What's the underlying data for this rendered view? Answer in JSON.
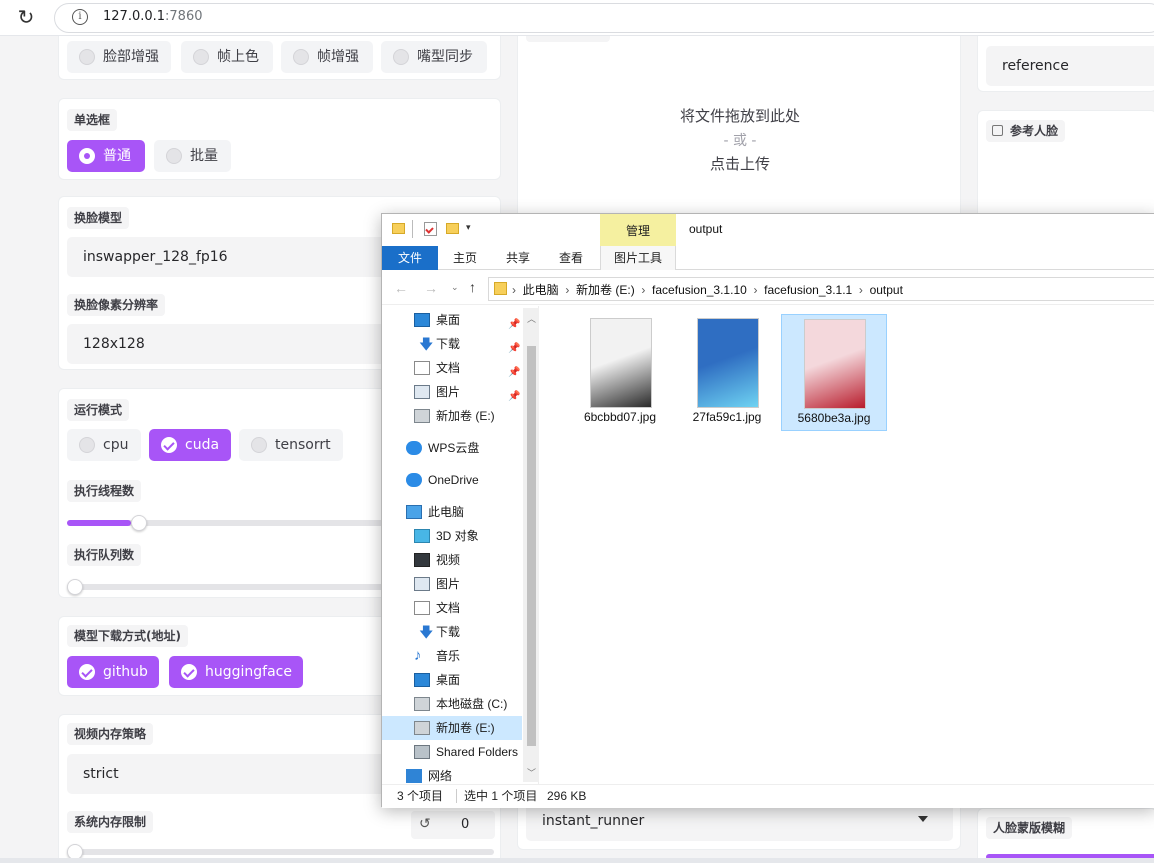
{
  "browser": {
    "reload_icon": "reload-icon",
    "info_icon": "i",
    "url_host": "127.0.0.1",
    "url_port": ":7860"
  },
  "left": {
    "processor_options": [
      "脸部增强",
      "帧上色",
      "帧增强",
      "嘴型同步"
    ],
    "radio_group": {
      "label": "单选框",
      "options": [
        "普通",
        "批量"
      ],
      "selected": "普通"
    },
    "swap_model": {
      "label": "换脸模型",
      "value": "inswapper_128_fp16"
    },
    "swap_resolution": {
      "label": "换脸像素分辨率",
      "value": "128x128"
    },
    "run_mode": {
      "label": "运行模式",
      "options": [
        "cpu",
        "cuda",
        "tensorrt"
      ],
      "checked": [
        "cuda"
      ]
    },
    "thread_count": {
      "label": "执行线程数",
      "value_fraction": 0.15
    },
    "queue_count": {
      "label": "执行队列数",
      "value_fraction": 0.0
    },
    "download": {
      "label": "模型下载方式(地址)",
      "options": [
        "github",
        "huggingface"
      ],
      "checked": [
        "github",
        "huggingface"
      ]
    },
    "video_memory": {
      "label": "视频内存策略",
      "value": "strict"
    },
    "system_memory": {
      "label": "系统内存限制",
      "reset_icon": "↺",
      "value": "0"
    }
  },
  "middle": {
    "upload": {
      "line1": "将文件拖放到此处",
      "line2": "- 或 -",
      "line3": "点击上传"
    },
    "runner": {
      "value": "instant_runner"
    }
  },
  "right": {
    "face_mode": {
      "value": "reference"
    },
    "reference_face": {
      "label": "参考人脸"
    },
    "mask_blur": {
      "label": "人脸蒙版模糊"
    }
  },
  "explorer": {
    "title": "output",
    "context_tab": "管理",
    "tabs": {
      "file": "文件",
      "home": "主页",
      "share": "共享",
      "view": "查看",
      "picture_tools": "图片工具"
    },
    "breadcrumb": [
      "此电脑",
      "新加卷 (E:)",
      "facefusion_3.1.10",
      "facefusion_3.1.1",
      "output"
    ],
    "nav": [
      {
        "label": "桌面",
        "icon": "desktop-icon",
        "pinned": true
      },
      {
        "label": "下载",
        "icon": "download-icon",
        "pinned": true
      },
      {
        "label": "文档",
        "icon": "document-icon",
        "pinned": true
      },
      {
        "label": "图片",
        "icon": "picture-icon",
        "pinned": true
      },
      {
        "label": "新加卷 (E:)",
        "icon": "drive-icon",
        "pinned": false
      },
      {
        "label": "WPS云盘",
        "icon": "cloud-icon",
        "pinned": false
      },
      {
        "label": "OneDrive",
        "icon": "cloud-icon",
        "pinned": false
      },
      {
        "label": "此电脑",
        "icon": "computer-icon",
        "pinned": false
      },
      {
        "label": "3D 对象",
        "icon": "cube-icon",
        "pinned": false
      },
      {
        "label": "视频",
        "icon": "video-icon",
        "pinned": false
      },
      {
        "label": "图片",
        "icon": "picture-icon",
        "pinned": false
      },
      {
        "label": "文档",
        "icon": "document-icon",
        "pinned": false
      },
      {
        "label": "下载",
        "icon": "download-icon",
        "pinned": false
      },
      {
        "label": "音乐",
        "icon": "music-icon",
        "pinned": false
      },
      {
        "label": "桌面",
        "icon": "desktop-icon",
        "pinned": false
      },
      {
        "label": "本地磁盘 (C:)",
        "icon": "drive-icon",
        "pinned": false
      },
      {
        "label": "新加卷 (E:)",
        "icon": "drive-icon",
        "pinned": false,
        "selected": true
      },
      {
        "label": "Shared Folders",
        "icon": "network-drive-icon",
        "pinned": false
      },
      {
        "label": "网络",
        "icon": "network-icon",
        "pinned": false
      }
    ],
    "files": [
      {
        "name": "6bcbbd07.jpg",
        "selected": false,
        "thumb_colors": [
          "#f2f2f2",
          "#2a2a2a"
        ]
      },
      {
        "name": "27fa59c1.jpg",
        "selected": false,
        "thumb_colors": [
          "#2f6ec2",
          "#6fd3f2"
        ]
      },
      {
        "name": "5680be3a.jpg",
        "selected": true,
        "thumb_colors": [
          "#f4d8dc",
          "#b81c2c"
        ]
      }
    ],
    "status": {
      "count": "3 个项目",
      "selection": "选中 1 个项目",
      "size": "296 KB"
    }
  },
  "colors": {
    "accent": "#a855f7",
    "explorer_selection": "#cce8ff",
    "context_tab": "#f5f0a0"
  }
}
